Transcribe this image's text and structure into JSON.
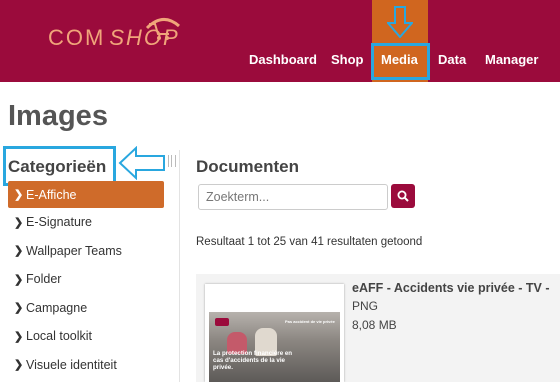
{
  "header": {
    "logo_part1": "COM",
    "logo_part2": "SHOP",
    "nav": [
      {
        "label": "Dashboard"
      },
      {
        "label": "Shop"
      },
      {
        "label": "Media"
      },
      {
        "label": "Data"
      },
      {
        "label": "Manager"
      }
    ],
    "active_nav": "Media"
  },
  "page": {
    "title": "Images"
  },
  "sidebar": {
    "title": "Categorieën",
    "items": [
      {
        "label": "E-Affiche"
      },
      {
        "label": "E-Signature"
      },
      {
        "label": "Wallpaper Teams"
      },
      {
        "label": "Folder"
      },
      {
        "label": "Campagne"
      },
      {
        "label": "Local toolkit"
      },
      {
        "label": "Visuele identiteit"
      }
    ],
    "active_item": "E-Affiche"
  },
  "main": {
    "title": "Documenten",
    "search": {
      "placeholder": "Zoekterm..."
    },
    "result_text": "Resultaat 1 tot 25 van 41 resultaten getoond",
    "documents": [
      {
        "title": "eAFF - Accidents vie privée - TV -",
        "type": "PNG",
        "size": "8,08 MB",
        "thumbnail": {
          "headline": "Pas accident de vie privée",
          "text": "La protection financière en cas d'accidents de la vie privée."
        }
      }
    ]
  },
  "colors": {
    "brand": "#9b0b3c",
    "accent": "#cf6b2a",
    "highlight": "#29a7df",
    "logo": "#f0a57a"
  },
  "icons": {
    "search_button": "search-icon",
    "sidebar_chevron": "chevron-right-icon",
    "annotation_down": "arrow-down-icon",
    "annotation_left": "arrow-left-icon"
  }
}
